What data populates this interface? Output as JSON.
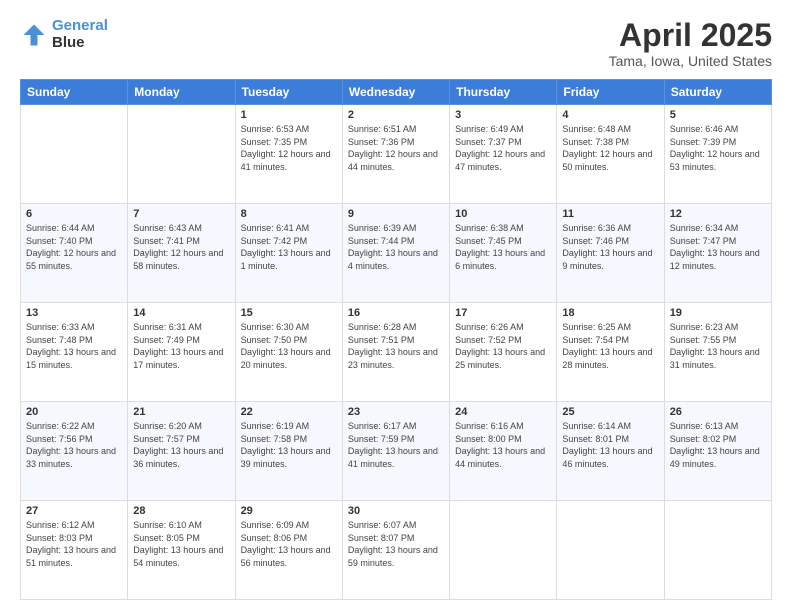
{
  "header": {
    "logo_line1": "General",
    "logo_line2": "Blue",
    "title": "April 2025",
    "subtitle": "Tama, Iowa, United States"
  },
  "days_of_week": [
    "Sunday",
    "Monday",
    "Tuesday",
    "Wednesday",
    "Thursday",
    "Friday",
    "Saturday"
  ],
  "weeks": [
    [
      {
        "num": "",
        "sunrise": "",
        "sunset": "",
        "daylight": ""
      },
      {
        "num": "",
        "sunrise": "",
        "sunset": "",
        "daylight": ""
      },
      {
        "num": "1",
        "sunrise": "Sunrise: 6:53 AM",
        "sunset": "Sunset: 7:35 PM",
        "daylight": "Daylight: 12 hours and 41 minutes."
      },
      {
        "num": "2",
        "sunrise": "Sunrise: 6:51 AM",
        "sunset": "Sunset: 7:36 PM",
        "daylight": "Daylight: 12 hours and 44 minutes."
      },
      {
        "num": "3",
        "sunrise": "Sunrise: 6:49 AM",
        "sunset": "Sunset: 7:37 PM",
        "daylight": "Daylight: 12 hours and 47 minutes."
      },
      {
        "num": "4",
        "sunrise": "Sunrise: 6:48 AM",
        "sunset": "Sunset: 7:38 PM",
        "daylight": "Daylight: 12 hours and 50 minutes."
      },
      {
        "num": "5",
        "sunrise": "Sunrise: 6:46 AM",
        "sunset": "Sunset: 7:39 PM",
        "daylight": "Daylight: 12 hours and 53 minutes."
      }
    ],
    [
      {
        "num": "6",
        "sunrise": "Sunrise: 6:44 AM",
        "sunset": "Sunset: 7:40 PM",
        "daylight": "Daylight: 12 hours and 55 minutes."
      },
      {
        "num": "7",
        "sunrise": "Sunrise: 6:43 AM",
        "sunset": "Sunset: 7:41 PM",
        "daylight": "Daylight: 12 hours and 58 minutes."
      },
      {
        "num": "8",
        "sunrise": "Sunrise: 6:41 AM",
        "sunset": "Sunset: 7:42 PM",
        "daylight": "Daylight: 13 hours and 1 minute."
      },
      {
        "num": "9",
        "sunrise": "Sunrise: 6:39 AM",
        "sunset": "Sunset: 7:44 PM",
        "daylight": "Daylight: 13 hours and 4 minutes."
      },
      {
        "num": "10",
        "sunrise": "Sunrise: 6:38 AM",
        "sunset": "Sunset: 7:45 PM",
        "daylight": "Daylight: 13 hours and 6 minutes."
      },
      {
        "num": "11",
        "sunrise": "Sunrise: 6:36 AM",
        "sunset": "Sunset: 7:46 PM",
        "daylight": "Daylight: 13 hours and 9 minutes."
      },
      {
        "num": "12",
        "sunrise": "Sunrise: 6:34 AM",
        "sunset": "Sunset: 7:47 PM",
        "daylight": "Daylight: 13 hours and 12 minutes."
      }
    ],
    [
      {
        "num": "13",
        "sunrise": "Sunrise: 6:33 AM",
        "sunset": "Sunset: 7:48 PM",
        "daylight": "Daylight: 13 hours and 15 minutes."
      },
      {
        "num": "14",
        "sunrise": "Sunrise: 6:31 AM",
        "sunset": "Sunset: 7:49 PM",
        "daylight": "Daylight: 13 hours and 17 minutes."
      },
      {
        "num": "15",
        "sunrise": "Sunrise: 6:30 AM",
        "sunset": "Sunset: 7:50 PM",
        "daylight": "Daylight: 13 hours and 20 minutes."
      },
      {
        "num": "16",
        "sunrise": "Sunrise: 6:28 AM",
        "sunset": "Sunset: 7:51 PM",
        "daylight": "Daylight: 13 hours and 23 minutes."
      },
      {
        "num": "17",
        "sunrise": "Sunrise: 6:26 AM",
        "sunset": "Sunset: 7:52 PM",
        "daylight": "Daylight: 13 hours and 25 minutes."
      },
      {
        "num": "18",
        "sunrise": "Sunrise: 6:25 AM",
        "sunset": "Sunset: 7:54 PM",
        "daylight": "Daylight: 13 hours and 28 minutes."
      },
      {
        "num": "19",
        "sunrise": "Sunrise: 6:23 AM",
        "sunset": "Sunset: 7:55 PM",
        "daylight": "Daylight: 13 hours and 31 minutes."
      }
    ],
    [
      {
        "num": "20",
        "sunrise": "Sunrise: 6:22 AM",
        "sunset": "Sunset: 7:56 PM",
        "daylight": "Daylight: 13 hours and 33 minutes."
      },
      {
        "num": "21",
        "sunrise": "Sunrise: 6:20 AM",
        "sunset": "Sunset: 7:57 PM",
        "daylight": "Daylight: 13 hours and 36 minutes."
      },
      {
        "num": "22",
        "sunrise": "Sunrise: 6:19 AM",
        "sunset": "Sunset: 7:58 PM",
        "daylight": "Daylight: 13 hours and 39 minutes."
      },
      {
        "num": "23",
        "sunrise": "Sunrise: 6:17 AM",
        "sunset": "Sunset: 7:59 PM",
        "daylight": "Daylight: 13 hours and 41 minutes."
      },
      {
        "num": "24",
        "sunrise": "Sunrise: 6:16 AM",
        "sunset": "Sunset: 8:00 PM",
        "daylight": "Daylight: 13 hours and 44 minutes."
      },
      {
        "num": "25",
        "sunrise": "Sunrise: 6:14 AM",
        "sunset": "Sunset: 8:01 PM",
        "daylight": "Daylight: 13 hours and 46 minutes."
      },
      {
        "num": "26",
        "sunrise": "Sunrise: 6:13 AM",
        "sunset": "Sunset: 8:02 PM",
        "daylight": "Daylight: 13 hours and 49 minutes."
      }
    ],
    [
      {
        "num": "27",
        "sunrise": "Sunrise: 6:12 AM",
        "sunset": "Sunset: 8:03 PM",
        "daylight": "Daylight: 13 hours and 51 minutes."
      },
      {
        "num": "28",
        "sunrise": "Sunrise: 6:10 AM",
        "sunset": "Sunset: 8:05 PM",
        "daylight": "Daylight: 13 hours and 54 minutes."
      },
      {
        "num": "29",
        "sunrise": "Sunrise: 6:09 AM",
        "sunset": "Sunset: 8:06 PM",
        "daylight": "Daylight: 13 hours and 56 minutes."
      },
      {
        "num": "30",
        "sunrise": "Sunrise: 6:07 AM",
        "sunset": "Sunset: 8:07 PM",
        "daylight": "Daylight: 13 hours and 59 minutes."
      },
      {
        "num": "",
        "sunrise": "",
        "sunset": "",
        "daylight": ""
      },
      {
        "num": "",
        "sunrise": "",
        "sunset": "",
        "daylight": ""
      },
      {
        "num": "",
        "sunrise": "",
        "sunset": "",
        "daylight": ""
      }
    ]
  ]
}
